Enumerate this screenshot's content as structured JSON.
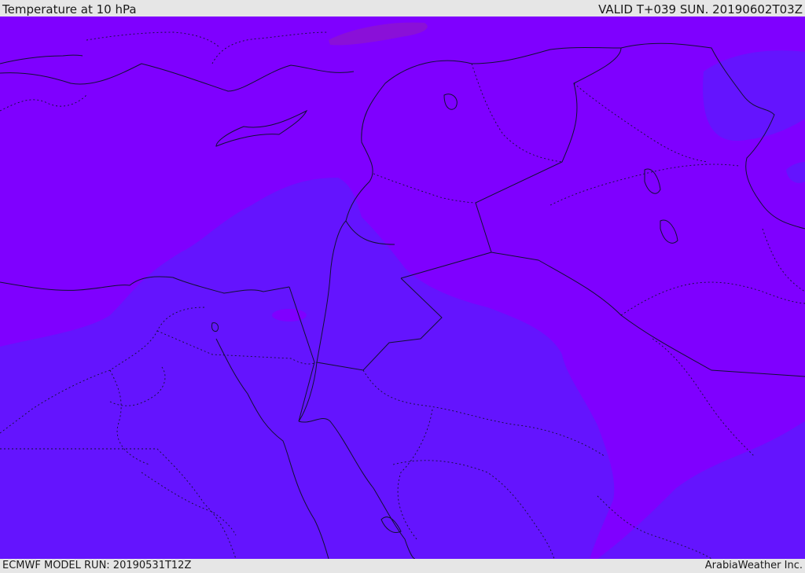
{
  "header": {
    "title": "Temperature at 10 hPa",
    "valid": "VALID T+039 SUN. 20190602T03Z"
  },
  "footer": {
    "model_run": "ECMWF MODEL RUN: 20190531T12Z",
    "credit": "ArabiaWeather Inc."
  },
  "map": {
    "colors": {
      "warm_field": "#7f00ff",
      "cool_field": "#6414fe",
      "warm_spot": "#8a10d8",
      "border": "#111133"
    }
  }
}
